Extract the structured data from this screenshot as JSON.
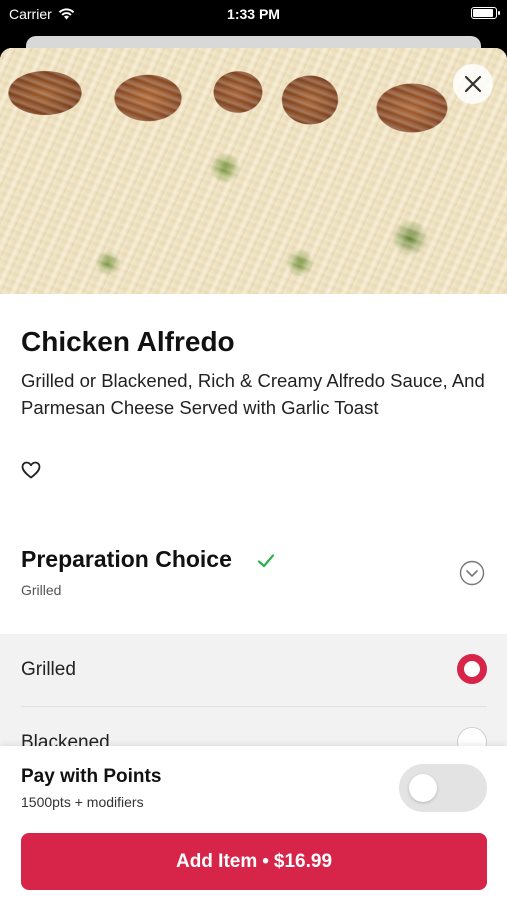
{
  "status_bar": {
    "carrier": "Carrier",
    "time": "1:33 PM"
  },
  "item": {
    "name": "Chicken Alfredo",
    "description": "Grilled or Blackened, Rich & Creamy Alfredo Sauce, And Parmesan Cheese Served with Garlic Toast"
  },
  "preparation": {
    "title": "Preparation Choice",
    "selected": "Grilled",
    "options": [
      {
        "label": "Grilled",
        "checked": true
      },
      {
        "label": "Blackened",
        "checked": false
      }
    ]
  },
  "points": {
    "title": "Pay with Points",
    "subtitle": "1500pts + modifiers",
    "enabled": false
  },
  "add_button": {
    "label": "Add Item",
    "separator": "•",
    "price": "$16.99"
  },
  "colors": {
    "accent": "#d7254a",
    "check": "#2bb24c"
  },
  "icons": {
    "close": "close-icon",
    "favorite": "heart-outline-icon",
    "check": "checkmark-icon",
    "expand": "chevron-down-circle-icon"
  }
}
